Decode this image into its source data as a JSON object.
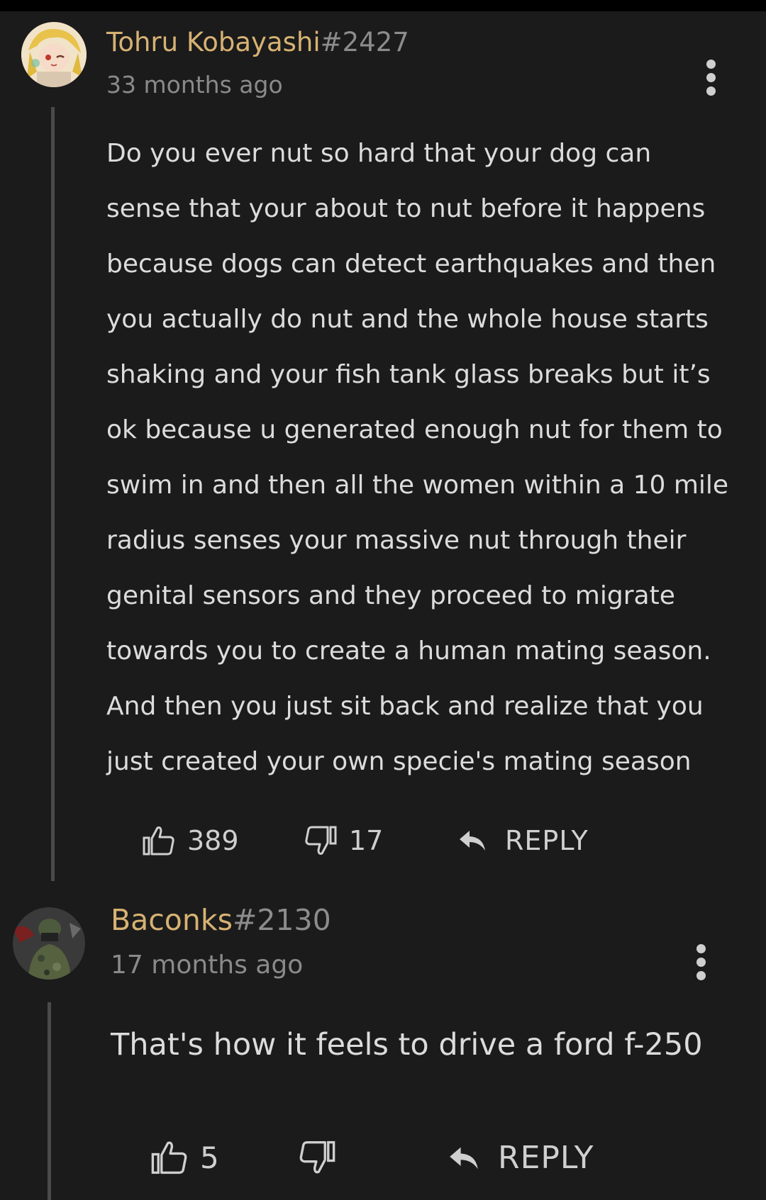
{
  "comments": [
    {
      "username": "Tohru Kobayashi",
      "tag": "#2427",
      "timestamp": "33 months ago",
      "body_lines": [
        "Do you ever nut so hard that your dog can",
        "sense that your about to nut before it happens",
        "because dogs can detect earthquakes and then",
        "you actually do nut and the whole house starts",
        "shaking and your fish tank glass breaks but it’s",
        "ok because u generated enough nut for them to",
        "swim in and then all the women within a 10 mile",
        "radius senses your massive nut through their",
        "genital sensors and they proceed to migrate",
        "towards you to create a human mating season.",
        "And then you just sit back and realize that you",
        "just created your own specie's mating season"
      ],
      "likes": "389",
      "dislikes": "17",
      "reply_label": "REPLY",
      "avatar_icon": "anime-avatar",
      "more_icon": "more-vertical-icon"
    },
    {
      "username": "Baconks",
      "tag": "#2130",
      "timestamp": "17 months ago",
      "body_lines": [
        "That's how it feels to drive a ford f-250"
      ],
      "likes": "5",
      "dislikes": "",
      "reply_label": "REPLY",
      "avatar_icon": "soldier-avatar",
      "more_icon": "more-vertical-icon"
    }
  ],
  "colors": {
    "background": "#1b1b1b",
    "username": "#d7b273",
    "tag": "#8c8c8c",
    "timestamp": "#8a8a8a",
    "body": "#dcdcdc"
  }
}
